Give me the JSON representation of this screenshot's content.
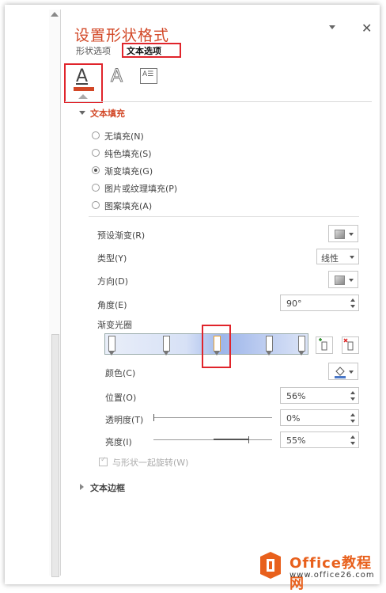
{
  "panel": {
    "title": "设置形状格式",
    "tabs": [
      {
        "label": "形状选项"
      },
      {
        "label": "文本选项"
      }
    ],
    "icons": {
      "text_fill_outline": "text-fill-icon",
      "text_effects": "text-effects-icon",
      "textbox": "textbox-icon"
    }
  },
  "text_fill": {
    "header": "文本填充",
    "options": [
      {
        "label": "无填充(N)"
      },
      {
        "label": "纯色填充(S)"
      },
      {
        "label": "渐变填充(G)",
        "selected": true
      },
      {
        "label": "图片或纹理填充(P)"
      },
      {
        "label": "图案填充(A)"
      }
    ],
    "preset_label": "预设渐变(R)",
    "type_label": "类型(Y)",
    "type_value": "线性",
    "direction_label": "方向(D)",
    "angle_label": "角度(E)",
    "angle_value": "90°",
    "stops_label": "渐变光圈",
    "color_label": "颜色(C)",
    "position_label": "位置(O)",
    "position_value": "56%",
    "transparency_label": "透明度(T)",
    "transparency_value": "0%",
    "brightness_label": "亮度(I)",
    "brightness_value": "55%",
    "rotate_label": "与形状一起旋转(W)",
    "colors": {
      "accent": "#d24726",
      "highlight": "#e0242b"
    },
    "transparency_level": 0,
    "brightness_level": 0.55
  },
  "text_border": {
    "header": "文本边框"
  },
  "watermark": {
    "brand": "Office教程网",
    "url": "www.office26.com"
  }
}
